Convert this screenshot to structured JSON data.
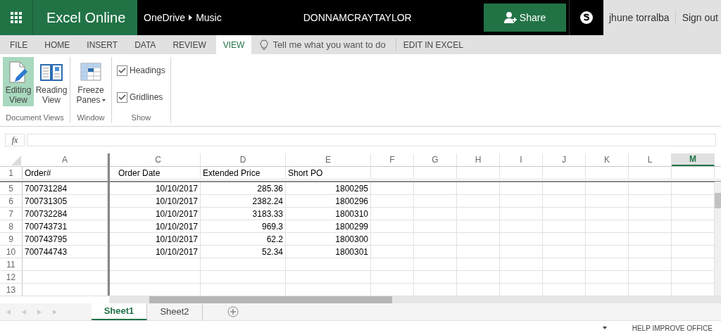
{
  "header": {
    "app_name": "Excel Online",
    "breadcrumb": [
      "OneDrive",
      "Music"
    ],
    "file_title": "DONNAMCRAYTAYLOR",
    "share_label": "Share",
    "user_name": "jhune torralba",
    "sign_out": "Sign out"
  },
  "tabs": [
    {
      "label": "FILE",
      "selected": false
    },
    {
      "label": "HOME",
      "selected": false
    },
    {
      "label": "INSERT",
      "selected": false
    },
    {
      "label": "DATA",
      "selected": false
    },
    {
      "label": "REVIEW",
      "selected": false
    },
    {
      "label": "VIEW",
      "selected": true
    }
  ],
  "tell_me": {
    "placeholder": "Tell me what you want to do"
  },
  "edit_in_excel": "EDIT IN EXCEL",
  "ribbon": [
    {
      "label": "Document Views",
      "items": [
        {
          "kind": "editing",
          "label": "Editing View",
          "selected": true
        },
        {
          "kind": "reading",
          "label": "Reading View",
          "selected": false
        }
      ]
    },
    {
      "label": "Window",
      "items": [
        {
          "kind": "freeze",
          "label": "Freeze Panes",
          "selected": false
        }
      ]
    },
    {
      "label": "Show",
      "items": [
        {
          "kind": "checkbox",
          "label": "Headings",
          "checked": true
        },
        {
          "kind": "checkbox",
          "label": "Gridlines",
          "checked": true
        }
      ]
    }
  ],
  "formula_bar": {
    "fx": "fx"
  },
  "grid": {
    "columns": [
      {
        "label": "A",
        "selected": false
      },
      {
        "label": "C",
        "selected": false
      },
      {
        "label": "D",
        "selected": false
      },
      {
        "label": "E",
        "selected": false
      },
      {
        "label": "F",
        "selected": false
      },
      {
        "label": "G",
        "selected": false
      },
      {
        "label": "H",
        "selected": false
      },
      {
        "label": "I",
        "selected": false
      },
      {
        "label": "J",
        "selected": false
      },
      {
        "label": "K",
        "selected": false
      },
      {
        "label": "L",
        "selected": false
      },
      {
        "label": "M",
        "selected": true
      }
    ],
    "rows": [
      {
        "header": "1",
        "kind": "header",
        "cells": [
          "Order#",
          "Order Date",
          "Extended Price",
          "Short PO"
        ]
      },
      {
        "header": "5",
        "kind": "data",
        "cells": [
          "700731284",
          "10/10/2017",
          "285.36",
          "1800295"
        ]
      },
      {
        "header": "6",
        "kind": "data",
        "cells": [
          "700731305",
          "10/10/2017",
          "2382.24",
          "1800296"
        ]
      },
      {
        "header": "7",
        "kind": "data",
        "cells": [
          "700732284",
          "10/10/2017",
          "3183.33",
          "1800310"
        ]
      },
      {
        "header": "8",
        "kind": "data",
        "cells": [
          "700743731",
          "10/10/2017",
          "969.3",
          "1800299"
        ]
      },
      {
        "header": "9",
        "kind": "data",
        "cells": [
          "700743795",
          "10/10/2017",
          "62.2",
          "1800300"
        ]
      },
      {
        "header": "10",
        "kind": "data",
        "cells": [
          "700744743",
          "10/10/2017",
          "52.34",
          "1800301"
        ]
      },
      {
        "header": "11",
        "kind": "empty",
        "cells": []
      },
      {
        "header": "12",
        "kind": "empty",
        "cells": []
      },
      {
        "header": "13",
        "kind": "empty",
        "cells": []
      }
    ]
  },
  "sheets": [
    {
      "label": "Sheet1",
      "selected": true
    },
    {
      "label": "Sheet2",
      "selected": false
    }
  ],
  "status_bar": {
    "help": "HELP IMPROVE OFFICE"
  }
}
